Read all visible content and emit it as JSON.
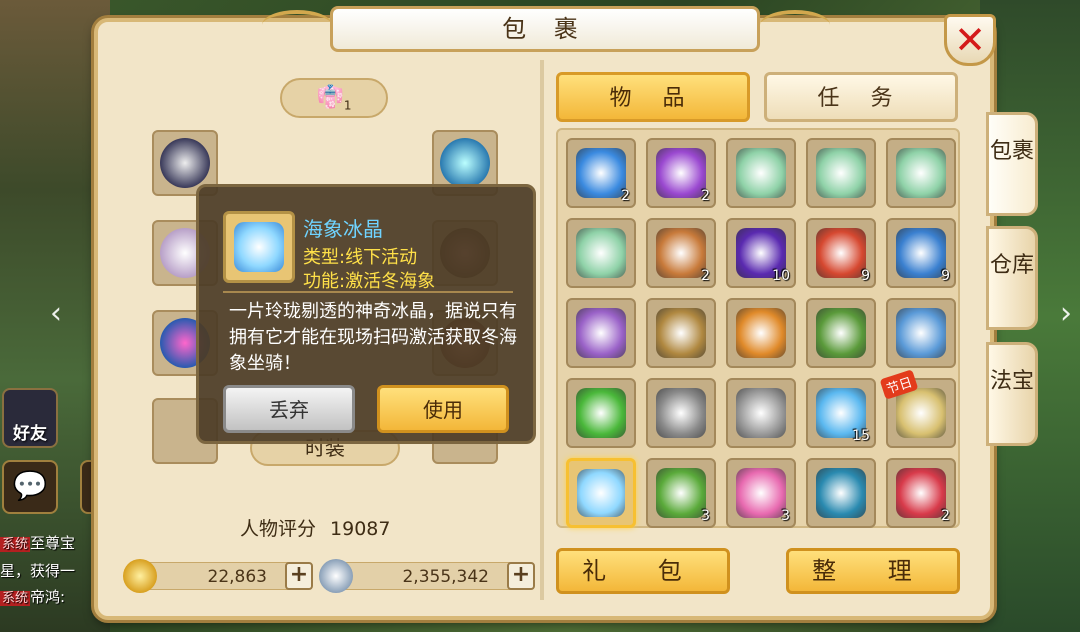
{
  "window": {
    "title": "包 裹",
    "close_symbol": "✕"
  },
  "hud": {
    "friend_label": "好友",
    "chat_lines": [
      {
        "tag": "系统",
        "text": "至尊宝"
      },
      {
        "tag": "",
        "text": "星，获得一"
      },
      {
        "tag": "系统",
        "text": "帝鸿:"
      }
    ]
  },
  "equipment": {
    "header_label": "1",
    "fashion_label": "时装",
    "score_label": "人物评分",
    "score_value": "19087"
  },
  "currency": {
    "gold": "22,863",
    "silver": "2,355,342",
    "plus": "+"
  },
  "tabs": {
    "items": "物 品",
    "quests": "任 务"
  },
  "side_tabs": [
    {
      "label": "包裹"
    },
    {
      "label": "仓库"
    },
    {
      "label": "法宝"
    }
  ],
  "bottom_buttons": {
    "gift": "礼 包",
    "sort": "整 理"
  },
  "inventory": [
    {
      "name": "blue-crystal",
      "count": "2",
      "color": "#3a8ae0"
    },
    {
      "name": "purple-crystal",
      "count": "2",
      "color": "#9a48d0"
    },
    {
      "name": "green-ticket",
      "count": "",
      "color": "#8fd2a8"
    },
    {
      "name": "green-ticket",
      "count": "",
      "color": "#8fd2a8"
    },
    {
      "name": "green-ticket",
      "count": "",
      "color": "#8fd2a8"
    },
    {
      "name": "green-ticket",
      "count": "",
      "color": "#8fd2a8"
    },
    {
      "name": "scroll",
      "count": "2",
      "color": "#c87a3a"
    },
    {
      "name": "purple-orb",
      "count": "10",
      "color": "#5a2ab0"
    },
    {
      "name": "red-bowl",
      "count": "9",
      "color": "#d64830"
    },
    {
      "name": "blue-bowl",
      "count": "9",
      "color": "#3a80d0"
    },
    {
      "name": "purple-pouch",
      "count": "",
      "color": "#9a62c8"
    },
    {
      "name": "fruit-crate",
      "count": "",
      "color": "#b08840"
    },
    {
      "name": "mooncake",
      "count": "",
      "color": "#e08a2a"
    },
    {
      "name": "bamboo",
      "count": "",
      "color": "#5a9a3a"
    },
    {
      "name": "blue-pouch",
      "count": "",
      "color": "#5a9ad8"
    },
    {
      "name": "green-gourd",
      "count": "",
      "color": "#4ab83a"
    },
    {
      "name": "stone-tablet",
      "count": "",
      "color": "#8a8a8a"
    },
    {
      "name": "stone-tablet",
      "count": "",
      "color": "#9a9a9a"
    },
    {
      "name": "ice-shards",
      "count": "15",
      "color": "#5ab8f0"
    },
    {
      "name": "cards",
      "count": "",
      "color": "#d8c070",
      "badge": "节日"
    },
    {
      "name": "ice-crystal",
      "count": "",
      "color": "#8fd8ff"
    },
    {
      "name": "green-bundle",
      "count": "3",
      "color": "#5aaa3a"
    },
    {
      "name": "rainbow-stone",
      "count": "3",
      "color": "#e86ab0"
    },
    {
      "name": "water-strip",
      "count": "",
      "color": "#2a8ab0"
    },
    {
      "name": "red-pouch",
      "count": "2",
      "color": "#d83a4a"
    }
  ],
  "tooltip": {
    "name": "海象冰晶",
    "type_line": "类型:线下活动",
    "func_line": "功能:激活冬海象",
    "description": "一片玲珑剔透的神奇冰晶，据说只有拥有它才能在现场扫码激活获取冬海象坐骑！",
    "discard": "丢弃",
    "use": "使用"
  }
}
